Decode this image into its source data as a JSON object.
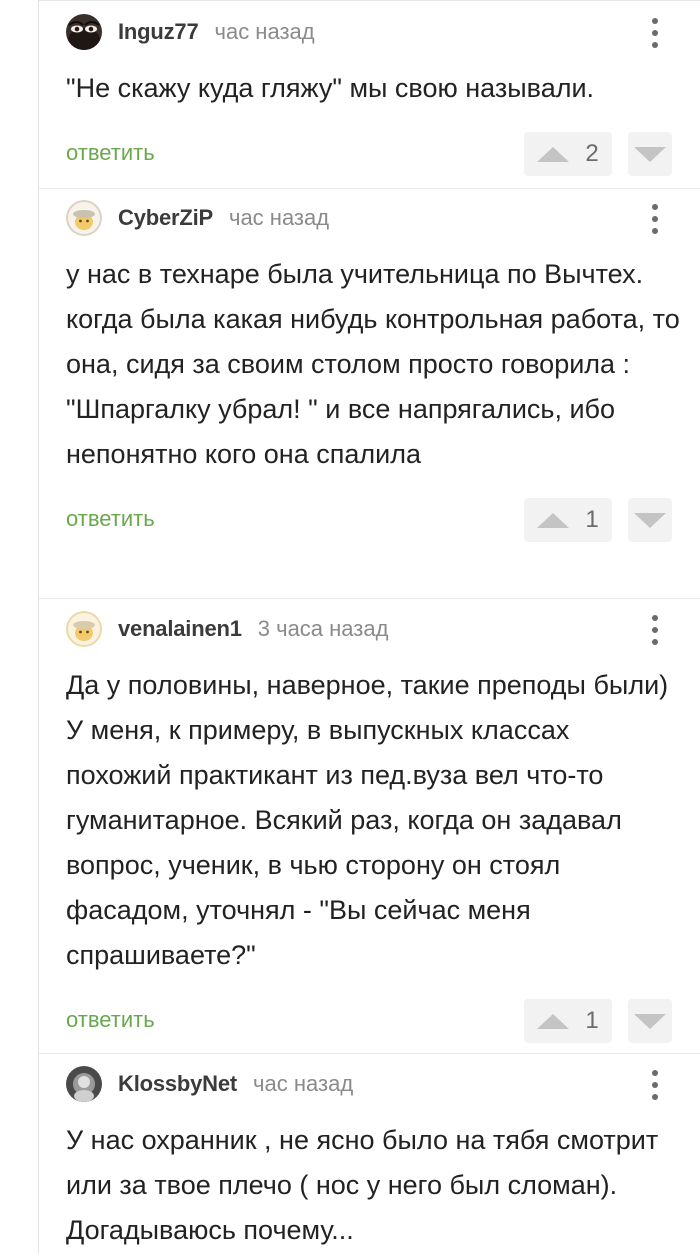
{
  "comments": [
    {
      "username": "Inguz77",
      "time": "час назад",
      "text": "\"Не скажу куда гляжу\" мы свою называли.",
      "reply_label": "ответить",
      "rating": "2",
      "avatar_icon": "dark-eyes-avatar-icon"
    },
    {
      "username": "CyberZiP",
      "time": "час назад",
      "text": "у нас в технаре была учительница по Вычтех. когда была какая нибудь контрольная работа, то она, сидя за своим столом просто говорила : \"Шпаргалку убрал! \" и все напрягались, ибо непонятно кого она спалила",
      "reply_label": "ответить",
      "rating": "1",
      "avatar_icon": "default-peekaboo-avatar-icon"
    },
    {
      "username": "venalainen1",
      "time": "3 часа назад",
      "text": "Да у половины, наверное, такие преподы были) У меня, к примеру, в выпускных классах похожий практикант из пед.вуза вел что-то гуманитарное. Всякий раз, когда он задавал вопрос, ученик, в чью сторону он стоял фасадом, уточнял - \"Вы сейчас меня спрашиваете?\"",
      "reply_label": "ответить",
      "rating": "1",
      "avatar_icon": "default-peekaboo-avatar-icon"
    },
    {
      "username": "KlossbyNet",
      "time": "час назад",
      "text": "У нас охранник , не ясно было на тябя смотрит или за твое плечо ( нос у него был сломан). Догадываюсь почему...",
      "avatar_icon": "gray-portrait-avatar-icon"
    }
  ],
  "colors": {
    "reply_green": "#6aa84f",
    "vote_background": "#f2f2f2",
    "vote_arrow": "#c4c4c4",
    "username_text": "#3b3b3b",
    "time_text": "#8a8a8a"
  }
}
